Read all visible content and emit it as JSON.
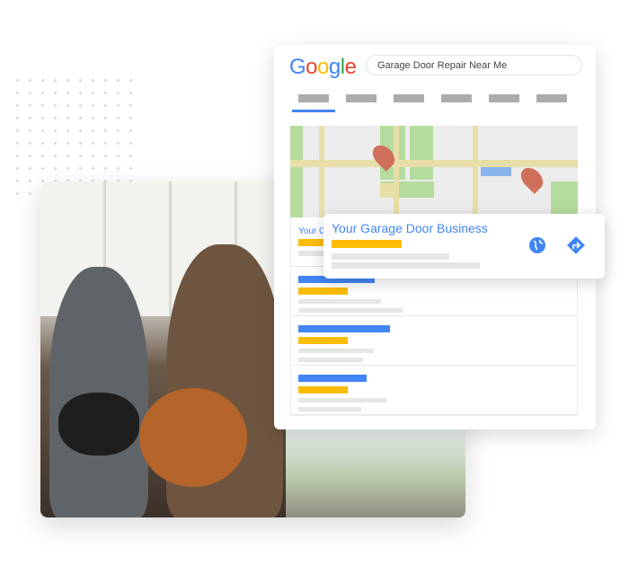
{
  "search": {
    "logo": "Google",
    "query": "Garage Door Repair Near Me"
  },
  "tabs": [
    {
      "active": true
    },
    {},
    {},
    {},
    {},
    {}
  ],
  "result_preview": "Your G",
  "popup": {
    "title": "Your Garage Door Business",
    "icons": [
      "globe-icon",
      "directions-icon"
    ]
  },
  "colors": {
    "blue": "#4285f4",
    "yellow": "#fbbc05",
    "pin": "#d0705c",
    "road": "#e8dfa8",
    "park": "#b5dc9e"
  }
}
